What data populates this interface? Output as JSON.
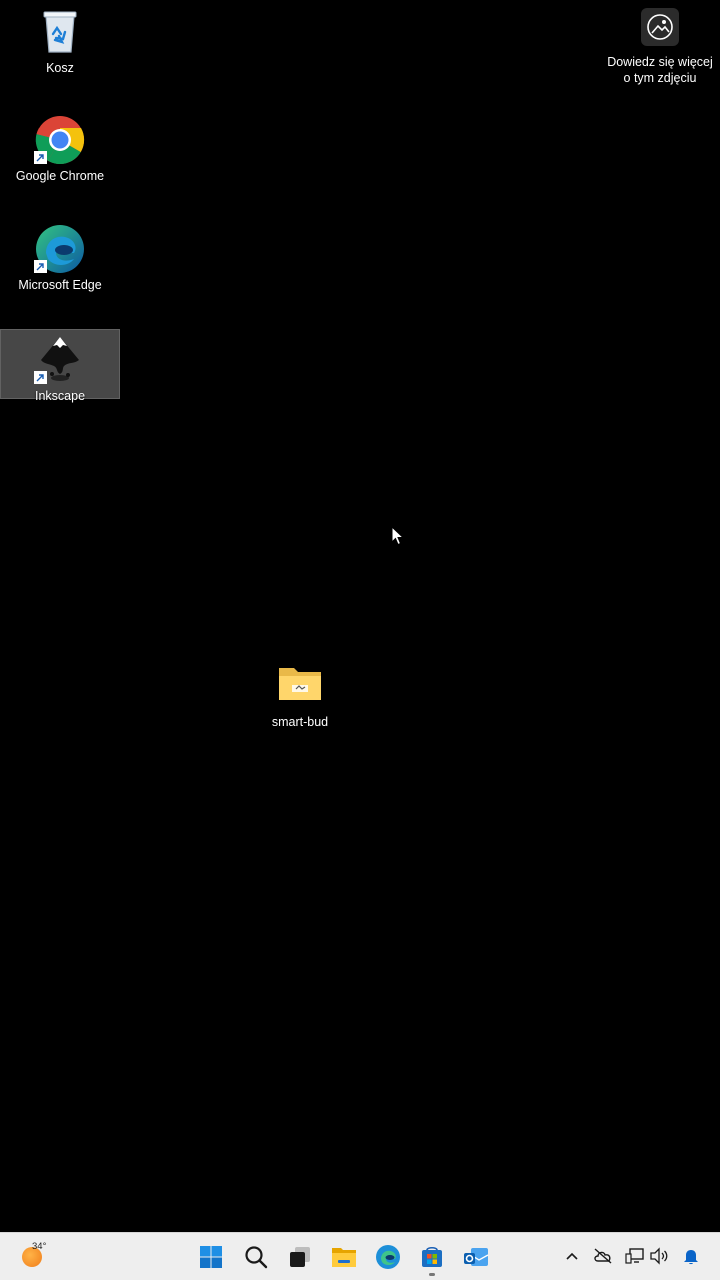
{
  "desktop": {
    "icons": [
      {
        "label": "Kosz",
        "icon": "recycle-bin-icon",
        "selected": false
      },
      {
        "label": "Google Chrome",
        "icon": "chrome-icon",
        "selected": false
      },
      {
        "label": "Microsoft Edge",
        "icon": "edge-icon",
        "selected": false
      },
      {
        "label": "Inkscape",
        "icon": "inkscape-icon",
        "selected": true
      },
      {
        "label": "smart-bud",
        "icon": "folder-icon",
        "selected": false
      }
    ],
    "spotlight": {
      "label": "Dowiedz się więcej o tym zdjęciu",
      "icon": "spotlight-camera-icon"
    }
  },
  "taskbar": {
    "weather": {
      "temp": "34°",
      "icon": "sun-icon"
    },
    "apps": [
      {
        "icon": "windows-start-icon"
      },
      {
        "icon": "search-icon"
      },
      {
        "icon": "task-view-icon"
      },
      {
        "icon": "file-explorer-icon"
      },
      {
        "icon": "edge-icon"
      },
      {
        "icon": "microsoft-store-icon",
        "running": true
      },
      {
        "icon": "outlook-icon"
      }
    ],
    "tray": [
      {
        "icon": "chevron-up-icon"
      },
      {
        "icon": "onedrive-offline-icon"
      },
      {
        "icon": "network-icon"
      },
      {
        "icon": "volume-icon"
      },
      {
        "icon": "notification-bell-icon"
      }
    ]
  },
  "colors": {
    "desktop_bg": "#000000",
    "taskbar_bg": "#eeeeee",
    "accent": "#0a64c8"
  }
}
